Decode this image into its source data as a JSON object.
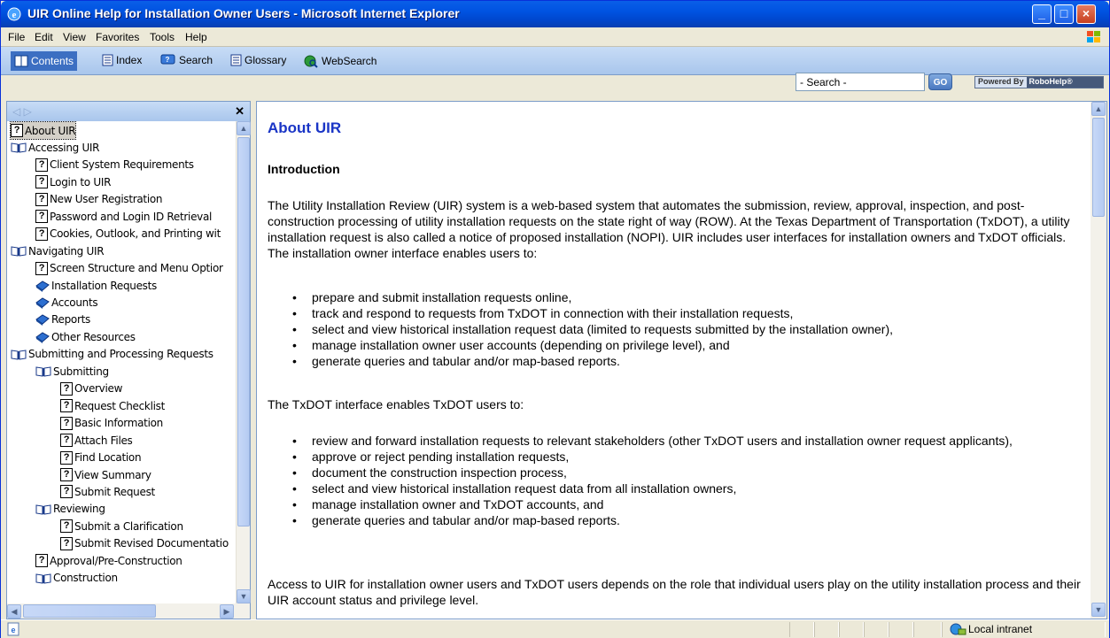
{
  "window": {
    "title": "UIR Online Help for Installation Owner Users - Microsoft Internet Explorer"
  },
  "menu": [
    "File",
    "Edit",
    "View",
    "Favorites",
    "Tools",
    "Help"
  ],
  "toolbar": {
    "contents": "Contents",
    "index": "Index",
    "search": "Search",
    "glossary": "Glossary",
    "websearch": "WebSearch",
    "search_value": "- Search -",
    "go": "GO",
    "powered_by": "Powered By",
    "robohelp": "RoboHelp®"
  },
  "tree": [
    {
      "label": "About UIR",
      "type": "page",
      "level": 0,
      "selected": true
    },
    {
      "label": "Accessing UIR",
      "type": "book-open",
      "level": 0
    },
    {
      "label": "Client System Requirements",
      "type": "page",
      "level": 1
    },
    {
      "label": "Login to UIR",
      "type": "page",
      "level": 1
    },
    {
      "label": "New User Registration",
      "type": "page",
      "level": 1
    },
    {
      "label": "Password and Login ID Retrieval",
      "type": "page",
      "level": 1
    },
    {
      "label": "Cookies, Outlook, and Printing wit",
      "type": "page",
      "level": 1
    },
    {
      "label": "Navigating UIR",
      "type": "book-open",
      "level": 0
    },
    {
      "label": "Screen Structure and Menu Optior",
      "type": "page",
      "level": 1
    },
    {
      "label": "Installation Requests",
      "type": "book-closed",
      "level": 1
    },
    {
      "label": "Accounts",
      "type": "book-closed",
      "level": 1
    },
    {
      "label": "Reports",
      "type": "book-closed",
      "level": 1
    },
    {
      "label": "Other Resources",
      "type": "book-closed",
      "level": 1
    },
    {
      "label": "Submitting and Processing Requests",
      "type": "book-open",
      "level": 0
    },
    {
      "label": "Submitting",
      "type": "book-open",
      "level": 1
    },
    {
      "label": "Overview",
      "type": "page",
      "level": 2
    },
    {
      "label": "Request Checklist",
      "type": "page",
      "level": 2
    },
    {
      "label": "Basic Information",
      "type": "page",
      "level": 2
    },
    {
      "label": "Attach Files",
      "type": "page",
      "level": 2
    },
    {
      "label": "Find Location",
      "type": "page",
      "level": 2
    },
    {
      "label": "View Summary",
      "type": "page",
      "level": 2
    },
    {
      "label": "Submit Request",
      "type": "page",
      "level": 2
    },
    {
      "label": "Reviewing",
      "type": "book-open",
      "level": 1
    },
    {
      "label": "Submit a Clarification",
      "type": "page",
      "level": 2
    },
    {
      "label": "Submit Revised Documentatio",
      "type": "page",
      "level": 2
    },
    {
      "label": "Approval/Pre-Construction",
      "type": "page",
      "level": 1
    },
    {
      "label": "Construction",
      "type": "book-open",
      "level": 1
    }
  ],
  "content": {
    "title": "About UIR",
    "heading": "Introduction",
    "intro": "The Utility Installation Review (UIR) system is a web-based system that automates the submission, review, approval, inspection, and post-construction processing of utility installation requests on the state right of way (ROW). At the Texas Department of Transportation (TxDOT), a utility installation request is also called a notice of proposed installation (NOPI). UIR includes user interfaces for installation owners and TxDOT officials. The installation owner interface enables users to:",
    "owner_bullets": [
      "prepare and submit installation requests online,",
      "track and respond to requests from TxDOT in connection with their installation requests,",
      "select and view historical installation request data (limited to requests submitted by the installation owner),",
      "manage installation owner user accounts (depending on privilege level), and",
      "generate queries and tabular and/or map-based reports."
    ],
    "txdot_intro": "The TxDOT interface enables TxDOT users to:",
    "txdot_bullets": [
      "review and forward installation requests to relevant stakeholders (other TxDOT users and installation owner request applicants),",
      "approve or reject pending installation requests,",
      "document the construction inspection process,",
      "select and view historical installation request data from all installation owners,",
      "manage installation owner and TxDOT accounts, and",
      "generate queries and tabular and/or map-based reports."
    ],
    "access": "Access to UIR for installation owner users and TxDOT users depends on the role that individual users play on the utility installation process and their UIR account status and privilege level."
  },
  "status": {
    "zone": "Local intranet"
  },
  "colors": {
    "title_blue": "#0053e1",
    "heading_blue": "#1a35c6",
    "toolbar": "#b8d0f0"
  }
}
